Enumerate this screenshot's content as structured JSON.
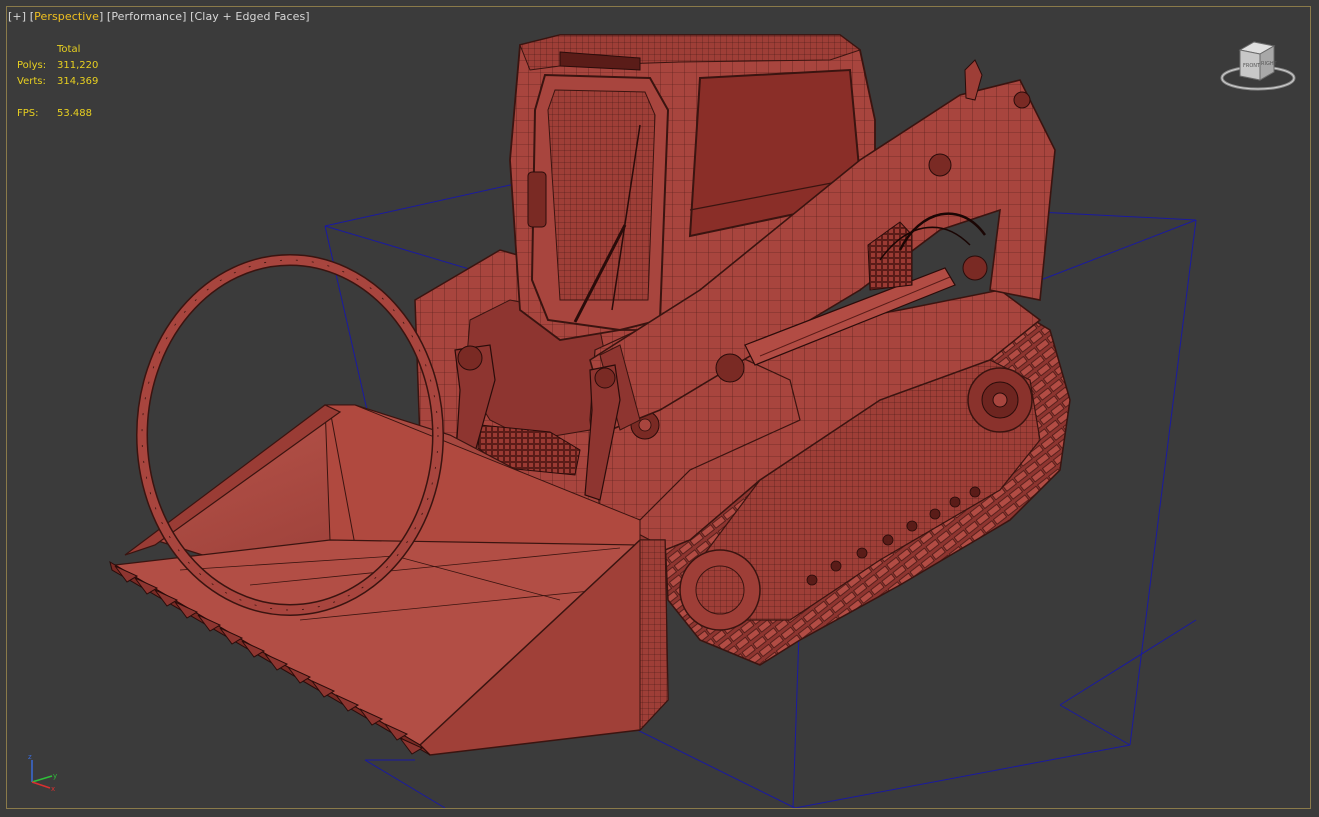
{
  "viewport": {
    "labels": {
      "plus": "+",
      "view": "Perspective",
      "mode": "Performance",
      "shading": "Clay + Edged Faces"
    },
    "stats": {
      "header": "Total",
      "polys_label": "Polys:",
      "polys_value": "311,220",
      "verts_label": "Verts:",
      "verts_value": "314,369",
      "fps_label": "FPS:",
      "fps_value": "53.488"
    },
    "viewcube": {
      "front": "FRONT",
      "right": "RIGHT"
    },
    "axis": {
      "x": "x",
      "y": "y",
      "z": "z"
    }
  },
  "colors": {
    "background": "#3b3b3b",
    "model": "#a8453e",
    "model_dark": "#7a2a24",
    "wire": "#3a1410",
    "bounding_box": "#1a1aa0",
    "active_label": "#f0c020",
    "stats_text": "#e8d020"
  },
  "scene": {
    "object": "compact-track-loader",
    "shading": "clay-edged-faces"
  }
}
